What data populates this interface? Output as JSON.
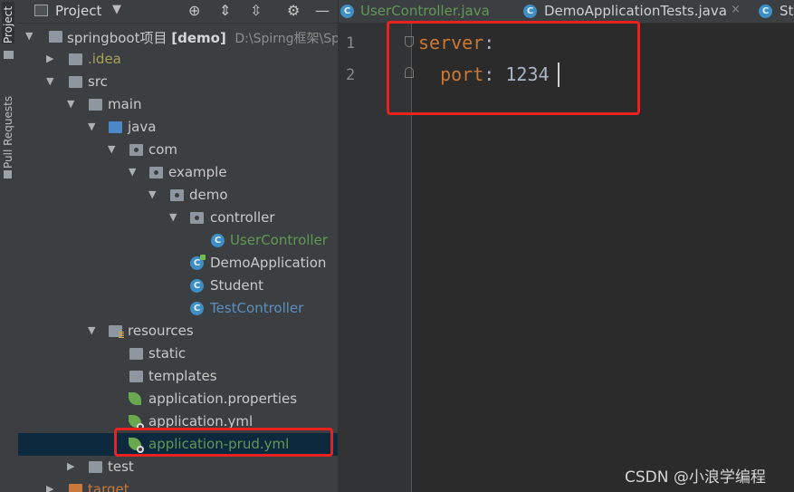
{
  "toolstrip": {
    "project_tab": "Project",
    "pull_requests_tab": "Pull Requests"
  },
  "panel": {
    "title": "Project",
    "caret": "▼",
    "buttons": {
      "locate": "⊕",
      "expand": "⇕",
      "collapse": "⇳",
      "settings": "⚙",
      "hide": "—"
    }
  },
  "tree": {
    "root": {
      "name": "springboot项目",
      "module": "[demo]",
      "path": "D:\\Spirng框架\\Sp"
    },
    "idea": ".idea",
    "src": "src",
    "main": "main",
    "java": "java",
    "com": "com",
    "example": "example",
    "demo": "demo",
    "controller": "controller",
    "user_controller": "UserController",
    "demo_application": "DemoApplication",
    "student": "Student",
    "test_controller": "TestController",
    "resources": "resources",
    "static": "static",
    "templates": "templates",
    "app_properties": "application.properties",
    "app_yml": "application.yml",
    "app_prud_yml": "application-prud.yml",
    "test": "test",
    "target": "target"
  },
  "editor": {
    "tabs": [
      {
        "label": "UserController.java",
        "icon": "C"
      },
      {
        "label": "DemoApplicationTests.java",
        "icon": "C"
      },
      {
        "label": "St",
        "icon": "C"
      }
    ],
    "close_glyph": "×",
    "line_numbers": [
      "1",
      "2"
    ],
    "lines": {
      "l1_key": "server",
      "l1_colon": ":",
      "l2_indent": "  ",
      "l2_key": "port",
      "l2_colon": ": ",
      "l2_value": "1234"
    }
  },
  "class_icon_letter": "C",
  "colors": {
    "highlight": "#e8231f",
    "yaml_key": "#cc7832",
    "vcs_added": "#629755",
    "vcs_modified": "#5c8fbd"
  },
  "watermark": "CSDN @小浪学编程"
}
